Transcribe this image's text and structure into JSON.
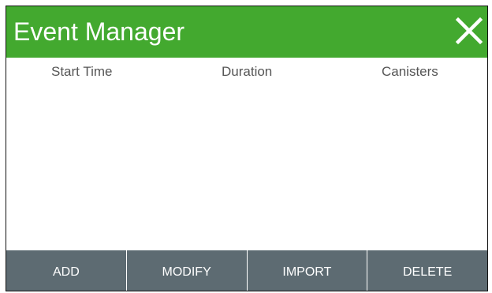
{
  "window": {
    "title": "Event Manager",
    "close_icon": "close-icon",
    "title_bar_color": "#43a92f"
  },
  "table": {
    "columns": [
      "Start Time",
      "Duration",
      "Canisters"
    ],
    "rows": []
  },
  "buttons": {
    "add": "ADD",
    "modify": "MODIFY",
    "import": "IMPORT",
    "delete": "DELETE",
    "bar_color": "#5d6b72"
  }
}
